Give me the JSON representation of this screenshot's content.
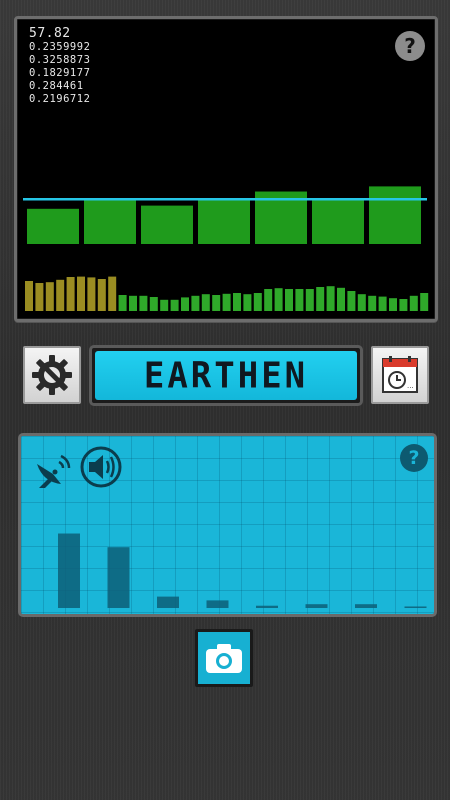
{
  "readout": {
    "main_value": "57.82",
    "lines": [
      "0.2359992",
      "0.3258873",
      "0.1829177",
      "0.284461",
      "0.2196712"
    ]
  },
  "top_help_label": "?",
  "title": "EARTHEN",
  "bottom_help_label": "?",
  "colors": {
    "accent_cyan": "#19b8da",
    "bar_green": "#1f9b1c",
    "threshold_line": "#26c6e6"
  },
  "icons": {
    "settings": "gear-wrench-icon",
    "history": "calendar-clock-icon",
    "satellite": "satellite-dish-icon",
    "speaker": "speaker-icon",
    "camera": "camera-icon"
  },
  "chart_data": [
    {
      "type": "bar",
      "name": "",
      "values": [
        0.55,
        0.7,
        0.6,
        0.7,
        0.82,
        0.68,
        0.9
      ],
      "threshold": 0.7,
      "ylim": [
        0,
        1
      ]
    },
    {
      "type": "bar",
      "values": [
        0.75,
        0.7,
        0.72,
        0.78,
        0.85,
        0.86,
        0.84,
        0.8,
        0.86,
        0.4,
        0.38,
        0.38,
        0.35,
        0.28,
        0.28,
        0.34,
        0.38,
        0.42,
        0.4,
        0.43,
        0.45,
        0.42,
        0.45,
        0.55,
        0.57,
        0.55,
        0.55,
        0.55,
        0.6,
        0.62,
        0.58,
        0.5,
        0.42,
        0.38,
        0.36,
        0.32,
        0.3,
        0.38,
        0.45
      ],
      "ylim": [
        0,
        1
      ]
    },
    {
      "type": "bar",
      "values": [
        0.98,
        0.8,
        0.15,
        0.1,
        0.03,
        0.05,
        0.05,
        0.02
      ],
      "ylim": [
        0,
        1
      ]
    }
  ]
}
